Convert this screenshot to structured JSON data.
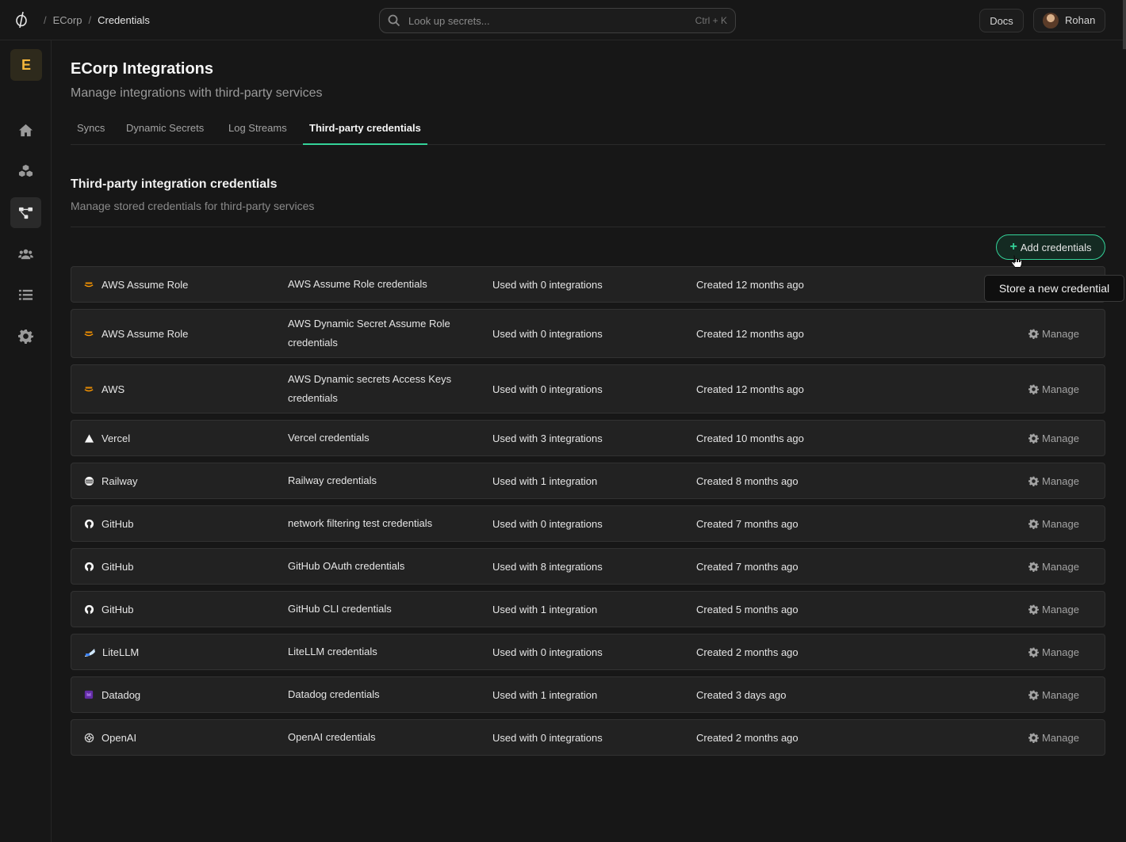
{
  "breadcrumb": {
    "org": "ECorp",
    "current": "Credentials"
  },
  "search": {
    "placeholder": "Look up secrets...",
    "shortcut": "Ctrl + K"
  },
  "header": {
    "docs_label": "Docs",
    "user_name": "Rohan"
  },
  "sidebar": {
    "org_initial": "E",
    "active_item": "integrations"
  },
  "page": {
    "title": "ECorp Integrations",
    "subtitle": "Manage integrations with third-party services"
  },
  "tabs": [
    {
      "label": "Syncs",
      "active": false
    },
    {
      "label": "Dynamic Secrets",
      "active": false
    },
    {
      "label": "Log Streams",
      "active": false
    },
    {
      "label": "Third-party credentials",
      "active": true
    }
  ],
  "section": {
    "title": "Third-party integration credentials",
    "subtitle": "Manage stored credentials for third-party services",
    "add_label": "Add credentials",
    "tooltip": "Store a new credential"
  },
  "credentials": [
    {
      "provider": "AWS Assume Role",
      "icon": "aws-icon",
      "name": "AWS Assume Role credentials",
      "usage": "Used with 0 integrations",
      "created": "Created 12 months ago",
      "manage": "Manage"
    },
    {
      "provider": "AWS Assume Role",
      "icon": "aws-icon",
      "name": "AWS Dynamic Secret Assume Role credentials",
      "usage": "Used with 0 integrations",
      "created": "Created 12 months ago",
      "manage": "Manage"
    },
    {
      "provider": "AWS",
      "icon": "aws-icon",
      "name": "AWS Dynamic secrets Access Keys credentials",
      "usage": "Used with 0 integrations",
      "created": "Created 12 months ago",
      "manage": "Manage"
    },
    {
      "provider": "Vercel",
      "icon": "vercel-icon",
      "name": "Vercel credentials",
      "usage": "Used with 3 integrations",
      "created": "Created 10 months ago",
      "manage": "Manage"
    },
    {
      "provider": "Railway",
      "icon": "railway-icon",
      "name": "Railway credentials",
      "usage": "Used with 1 integration",
      "created": "Created 8 months ago",
      "manage": "Manage"
    },
    {
      "provider": "GitHub",
      "icon": "github-icon",
      "name": "network filtering test credentials",
      "usage": "Used with 0 integrations",
      "created": "Created 7 months ago",
      "manage": "Manage"
    },
    {
      "provider": "GitHub",
      "icon": "github-icon",
      "name": "GitHub OAuth credentials",
      "usage": "Used with 8 integrations",
      "created": "Created 7 months ago",
      "manage": "Manage"
    },
    {
      "provider": "GitHub",
      "icon": "github-icon",
      "name": "GitHub CLI credentials",
      "usage": "Used with 1 integration",
      "created": "Created 5 months ago",
      "manage": "Manage"
    },
    {
      "provider": "LiteLLM",
      "icon": "litellm-icon",
      "name": "LiteLLM credentials",
      "usage": "Used with 0 integrations",
      "created": "Created 2 months ago",
      "manage": "Manage"
    },
    {
      "provider": "Datadog",
      "icon": "datadog-icon",
      "name": "Datadog credentials",
      "usage": "Used with 1 integration",
      "created": "Created 3 days ago",
      "manage": "Manage"
    },
    {
      "provider": "OpenAI",
      "icon": "openai-icon",
      "name": "OpenAI credentials",
      "usage": "Used with 0 integrations",
      "created": "Created 2 months ago",
      "manage": "Manage"
    }
  ],
  "colors": {
    "accent": "#34d399",
    "background": "#171717",
    "row": "#222222",
    "org_badge": "#f5b63b"
  }
}
